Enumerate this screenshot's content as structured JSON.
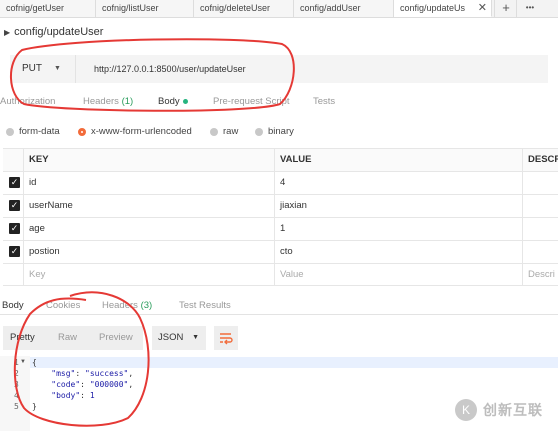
{
  "tabs": [
    {
      "label": "cofnig/getUser"
    },
    {
      "label": "cofnig/listUser"
    },
    {
      "label": "cofnig/deleteUser"
    },
    {
      "label": "config/addUser"
    },
    {
      "label": "config/updateUs"
    }
  ],
  "tabbar": {
    "close": "✕",
    "add": "+",
    "more": "•••"
  },
  "request": {
    "title": "config/updateUser",
    "method": "PUT",
    "url": "http://127.0.0.1:8500/user/updateUser"
  },
  "request_tabs": {
    "authorization": "Authorization",
    "headers": "Headers",
    "headers_count": "(1)",
    "body": "Body",
    "prerequest": "Pre-request Script",
    "tests": "Tests"
  },
  "body_types": {
    "form_data": "form-data",
    "urlencoded": "x-www-form-urlencoded",
    "raw": "raw",
    "binary": "binary",
    "selected": "x-www-form-urlencoded"
  },
  "params": {
    "headers": {
      "key": "KEY",
      "value": "VALUE",
      "description": "DESCRI"
    },
    "rows": [
      {
        "key": "id",
        "value": "4",
        "checked": true
      },
      {
        "key": "userName",
        "value": "jiaxian",
        "checked": true
      },
      {
        "key": "age",
        "value": "1",
        "checked": true
      },
      {
        "key": "postion",
        "value": "cto",
        "checked": true
      }
    ],
    "placeholder": {
      "key": "Key",
      "value": "Value",
      "description": "Descri"
    }
  },
  "response_tabs": {
    "body": "Body",
    "cookies": "Cookies",
    "headers": "Headers",
    "headers_count": "(3)",
    "tests": "Test Results"
  },
  "response_toolbar": {
    "pretty": "Pretty",
    "raw": "Raw",
    "preview": "Preview",
    "format": "JSON"
  },
  "response_body": {
    "line_numbers": [
      "1",
      "2",
      "3",
      "4",
      "5"
    ],
    "open": "{",
    "msg_key": "\"msg\"",
    "msg_val": "\"success\"",
    "code_key": "\"code\"",
    "code_val": "\"000000\"",
    "body_key": "\"body\"",
    "body_val": "1",
    "close": "}"
  },
  "watermark": {
    "text": "创新互联",
    "logo": "K"
  },
  "colors": {
    "accent": "#f26b3a",
    "annotation": "#e53935",
    "dot": "#26b47f",
    "count": "#2a9d5c"
  }
}
